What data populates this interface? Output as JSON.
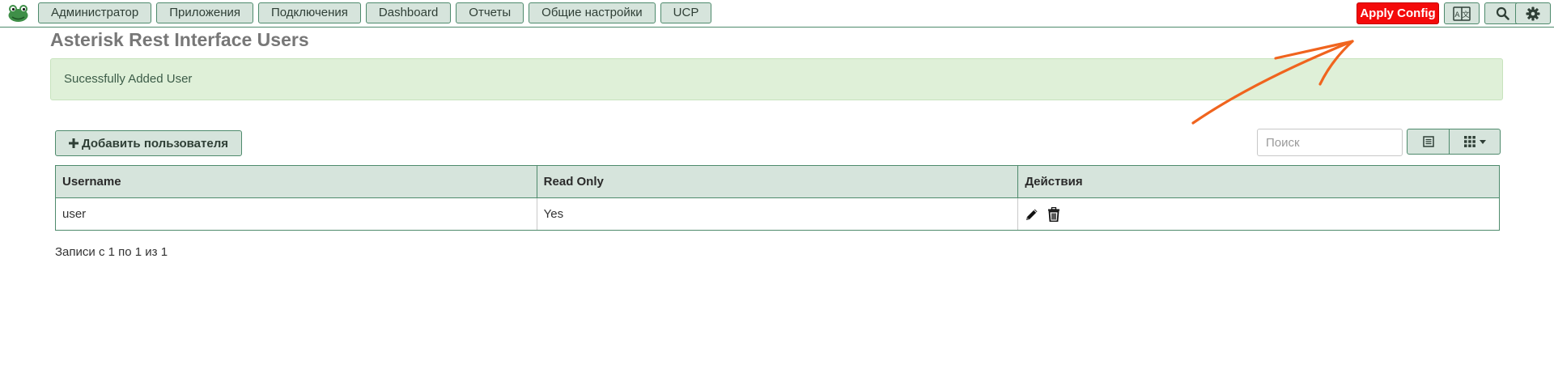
{
  "navbar": {
    "logo_icon": "frog-logo-icon",
    "menu": [
      {
        "label": "Администратор"
      },
      {
        "label": "Приложения"
      },
      {
        "label": "Подключения"
      },
      {
        "label": "Dashboard"
      },
      {
        "label": "Отчеты"
      },
      {
        "label": "Общие настройки"
      },
      {
        "label": "UCP"
      }
    ],
    "apply_config_label": "Apply Config",
    "apply_config_color": "#f40a0a",
    "icons": [
      "language-icon",
      "search-icon",
      "gear-icon"
    ]
  },
  "page": {
    "title": "Asterisk Rest Interface Users",
    "alert_text": "Sucessfully Added User",
    "alert_color": "#dff0d8"
  },
  "toolbar": {
    "add_user_label": "Добавить пользователя",
    "search_placeholder": "Поиск",
    "search_value": ""
  },
  "table": {
    "columns": [
      "Username",
      "Read Only",
      "Действия"
    ],
    "rows": [
      {
        "username": "user",
        "read_only": "Yes",
        "actions": [
          "edit-icon",
          "delete-icon"
        ]
      }
    ]
  },
  "pagination": {
    "info": "Записи с 1 по 1 из 1"
  },
  "annotation": {
    "arrow_color": "#f0641e",
    "points_to": "apply-config-button"
  },
  "accent_color": "#4e8a6c",
  "button_bg": "#d6e4dc"
}
